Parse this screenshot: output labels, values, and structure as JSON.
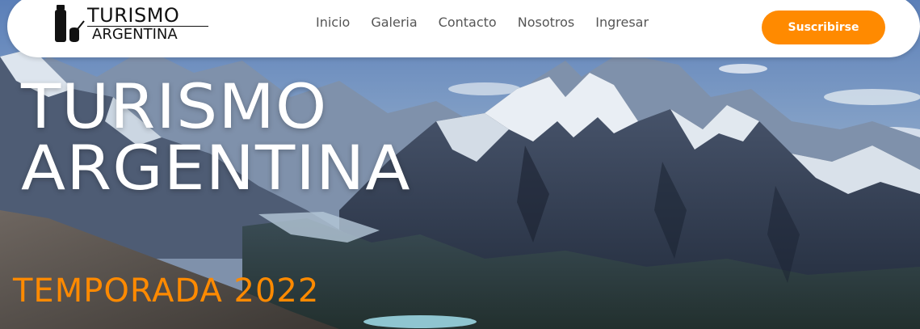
{
  "brand": {
    "line1": "TURISMO",
    "line2": "ARGENTINA",
    "icon": "thermos-mate-icon"
  },
  "nav": {
    "items": [
      {
        "label": "Inicio"
      },
      {
        "label": "Galeria"
      },
      {
        "label": "Contacto"
      },
      {
        "label": "Nosotros"
      },
      {
        "label": "Ingresar"
      }
    ]
  },
  "subscribe": {
    "label": "Suscribirse"
  },
  "hero": {
    "title_line1": "TURISMO",
    "title_line2": "ARGENTINA",
    "tagline": "TEMPORADA 2022",
    "background": "patagonia-mountains-photo"
  },
  "colors": {
    "accent": "#ff8a00",
    "navbar_bg": "#ffffff",
    "nav_text": "#555555",
    "hero_title": "#ffffff"
  }
}
